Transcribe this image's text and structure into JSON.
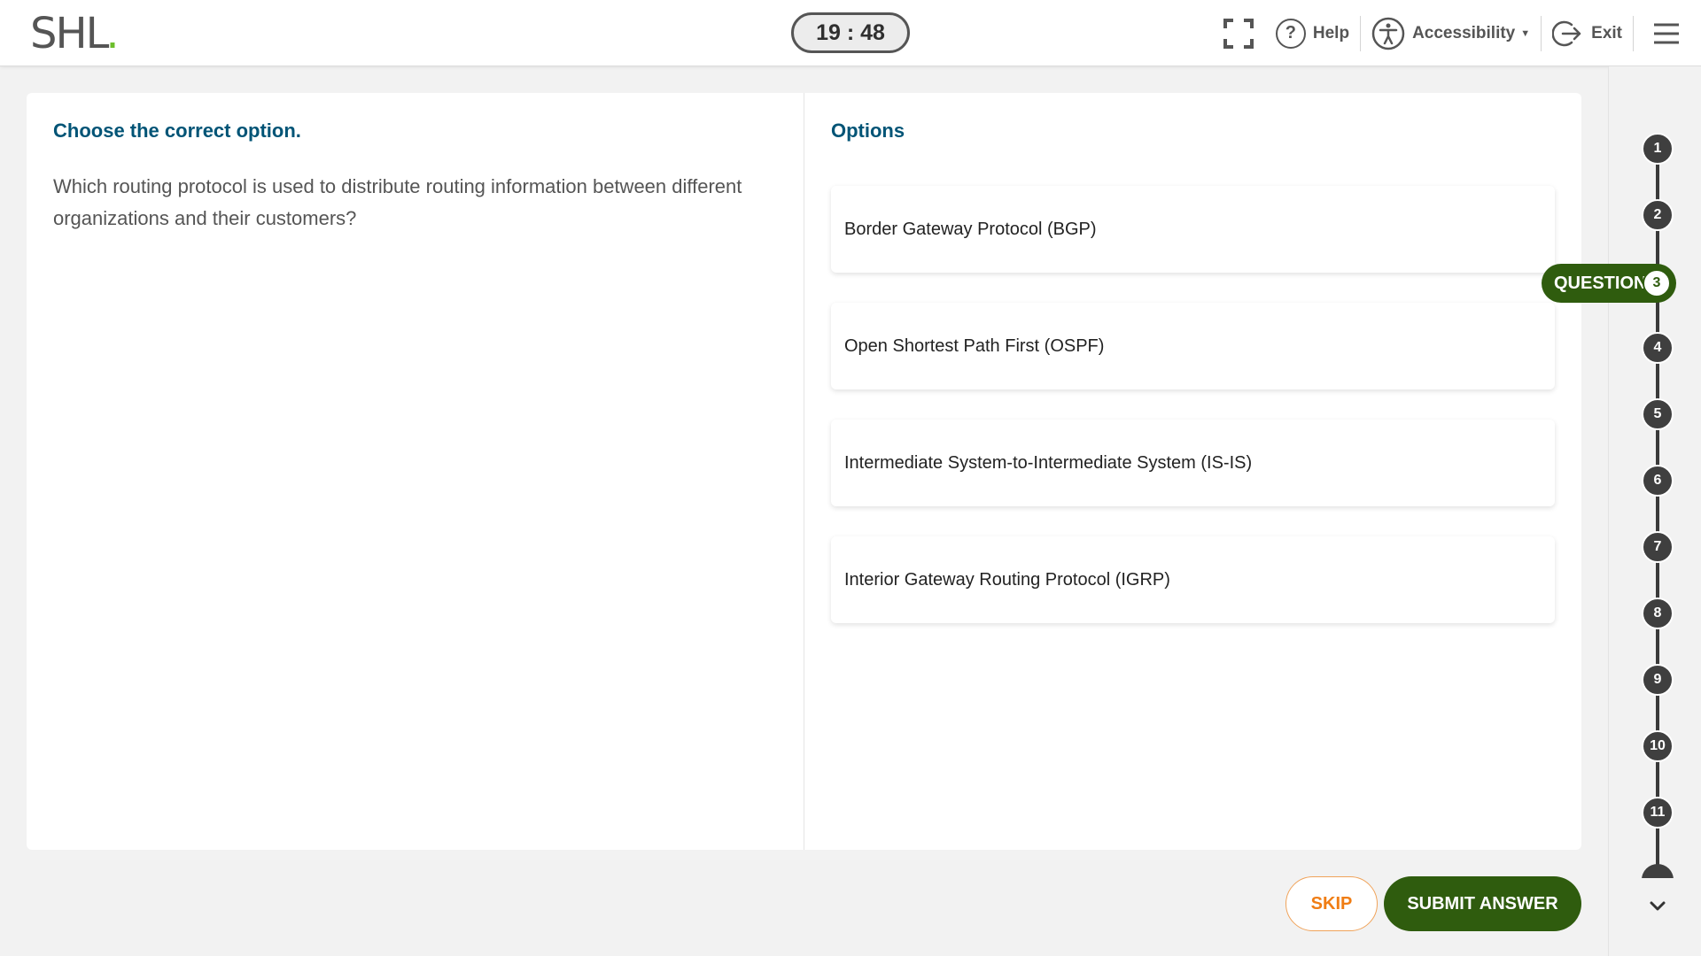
{
  "header": {
    "logo_text": "SHL",
    "logo_dot": ".",
    "timer": "19 : 48",
    "help_label": "Help",
    "accessibility_label": "Accessibility",
    "exit_label": "Exit"
  },
  "question": {
    "instruction": "Choose the correct option.",
    "text": "Which routing protocol is used to distribute routing information between different organizations and their customers?"
  },
  "options": {
    "title": "Options",
    "items": [
      "Border Gateway Protocol (BGP)",
      "Open Shortest Path First (OSPF)",
      "Intermediate System-to-Intermediate System (IS-IS)",
      "Interior Gateway Routing Protocol (IGRP)"
    ]
  },
  "progress": {
    "current_label": "QUESTION",
    "current_number": "3",
    "steps": [
      "1",
      "2",
      "4",
      "5",
      "6",
      "7",
      "8",
      "9",
      "10",
      "11"
    ]
  },
  "actions": {
    "skip_label": "SKIP",
    "submit_label": "SUBMIT ANSWER"
  },
  "colors": {
    "brand_green": "#2f5c0e",
    "heading_blue": "#005476",
    "skip_orange": "#f07d14",
    "logo_dot_green": "#6cbe2b"
  }
}
